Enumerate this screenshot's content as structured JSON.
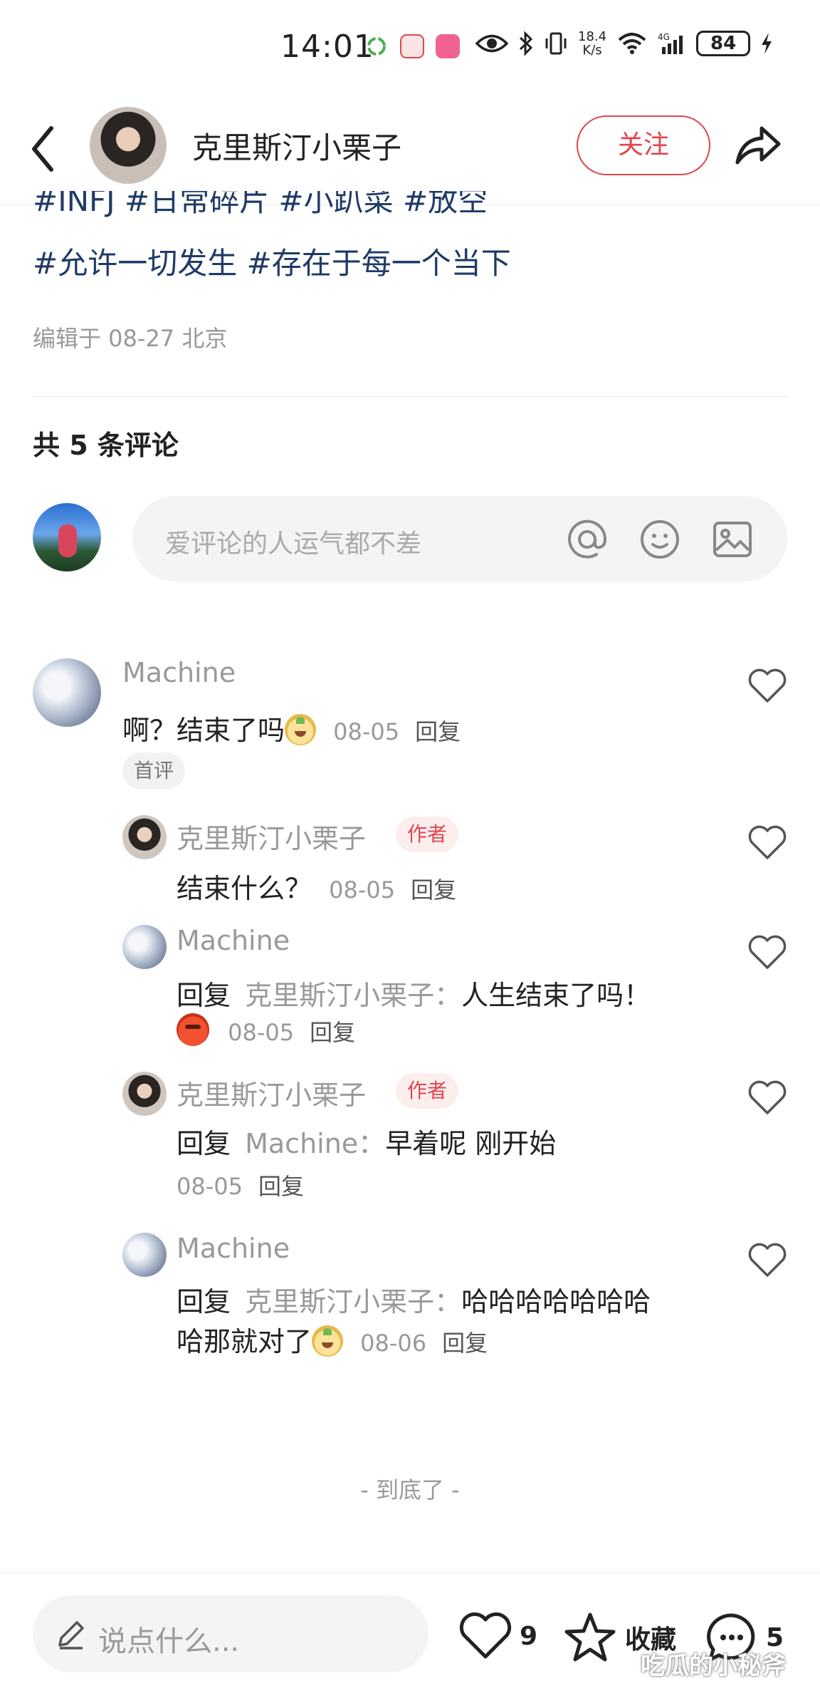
{
  "status_bar": {
    "time": "14:01",
    "speed_top": "18.4",
    "speed_bottom": "K/s",
    "network": "6",
    "cell": "4G",
    "battery": "84"
  },
  "header": {
    "author_name": "克里斯汀小栗子",
    "follow_label": "关注"
  },
  "post": {
    "tags_line1": "#INFJ #日常碎片 #小趴菜 #放空",
    "tags_line2": "#允许一切发生 #存在于每一个当下",
    "edit_info": "编辑于 08-27 北京"
  },
  "comments_section": {
    "count_label": "共 5 条评论",
    "input_placeholder": "爱评论的人运气都不差"
  },
  "comments": [
    {
      "user": "Machine",
      "text": "啊？结束了吗",
      "date": "08-05",
      "reply_label": "回复",
      "badge": "首评"
    },
    {
      "user": "克里斯汀小栗子",
      "badge": "作者",
      "text": "结束什么？",
      "date": "08-05",
      "reply_label": "回复"
    },
    {
      "user": "Machine",
      "reply_prefix": "回复",
      "reply_to": "克里斯汀小栗子：",
      "text": "人生结束了吗！",
      "date": "08-05",
      "reply_label": "回复"
    },
    {
      "user": "克里斯汀小栗子",
      "badge": "作者",
      "reply_prefix": "回复",
      "reply_to": "Machine：",
      "text": "早着呢 刚开始",
      "date": "08-05",
      "reply_label": "回复"
    },
    {
      "user": "Machine",
      "reply_prefix": "回复",
      "reply_to": "克里斯汀小栗子：",
      "text_line1": "哈哈哈哈哈哈哈",
      "text_line2": "哈那就对了",
      "date": "08-06",
      "reply_label": "回复"
    }
  ],
  "end_text": "- 到底了 -",
  "bottom_bar": {
    "input_placeholder": "说点什么...",
    "likes": "9",
    "favorite_label": "收藏",
    "comments": "5"
  },
  "watermark": "吃瓜的小秘斧",
  "colors": {
    "accent": "#e0464d",
    "tag": "#1f3a66",
    "muted": "#999999"
  }
}
